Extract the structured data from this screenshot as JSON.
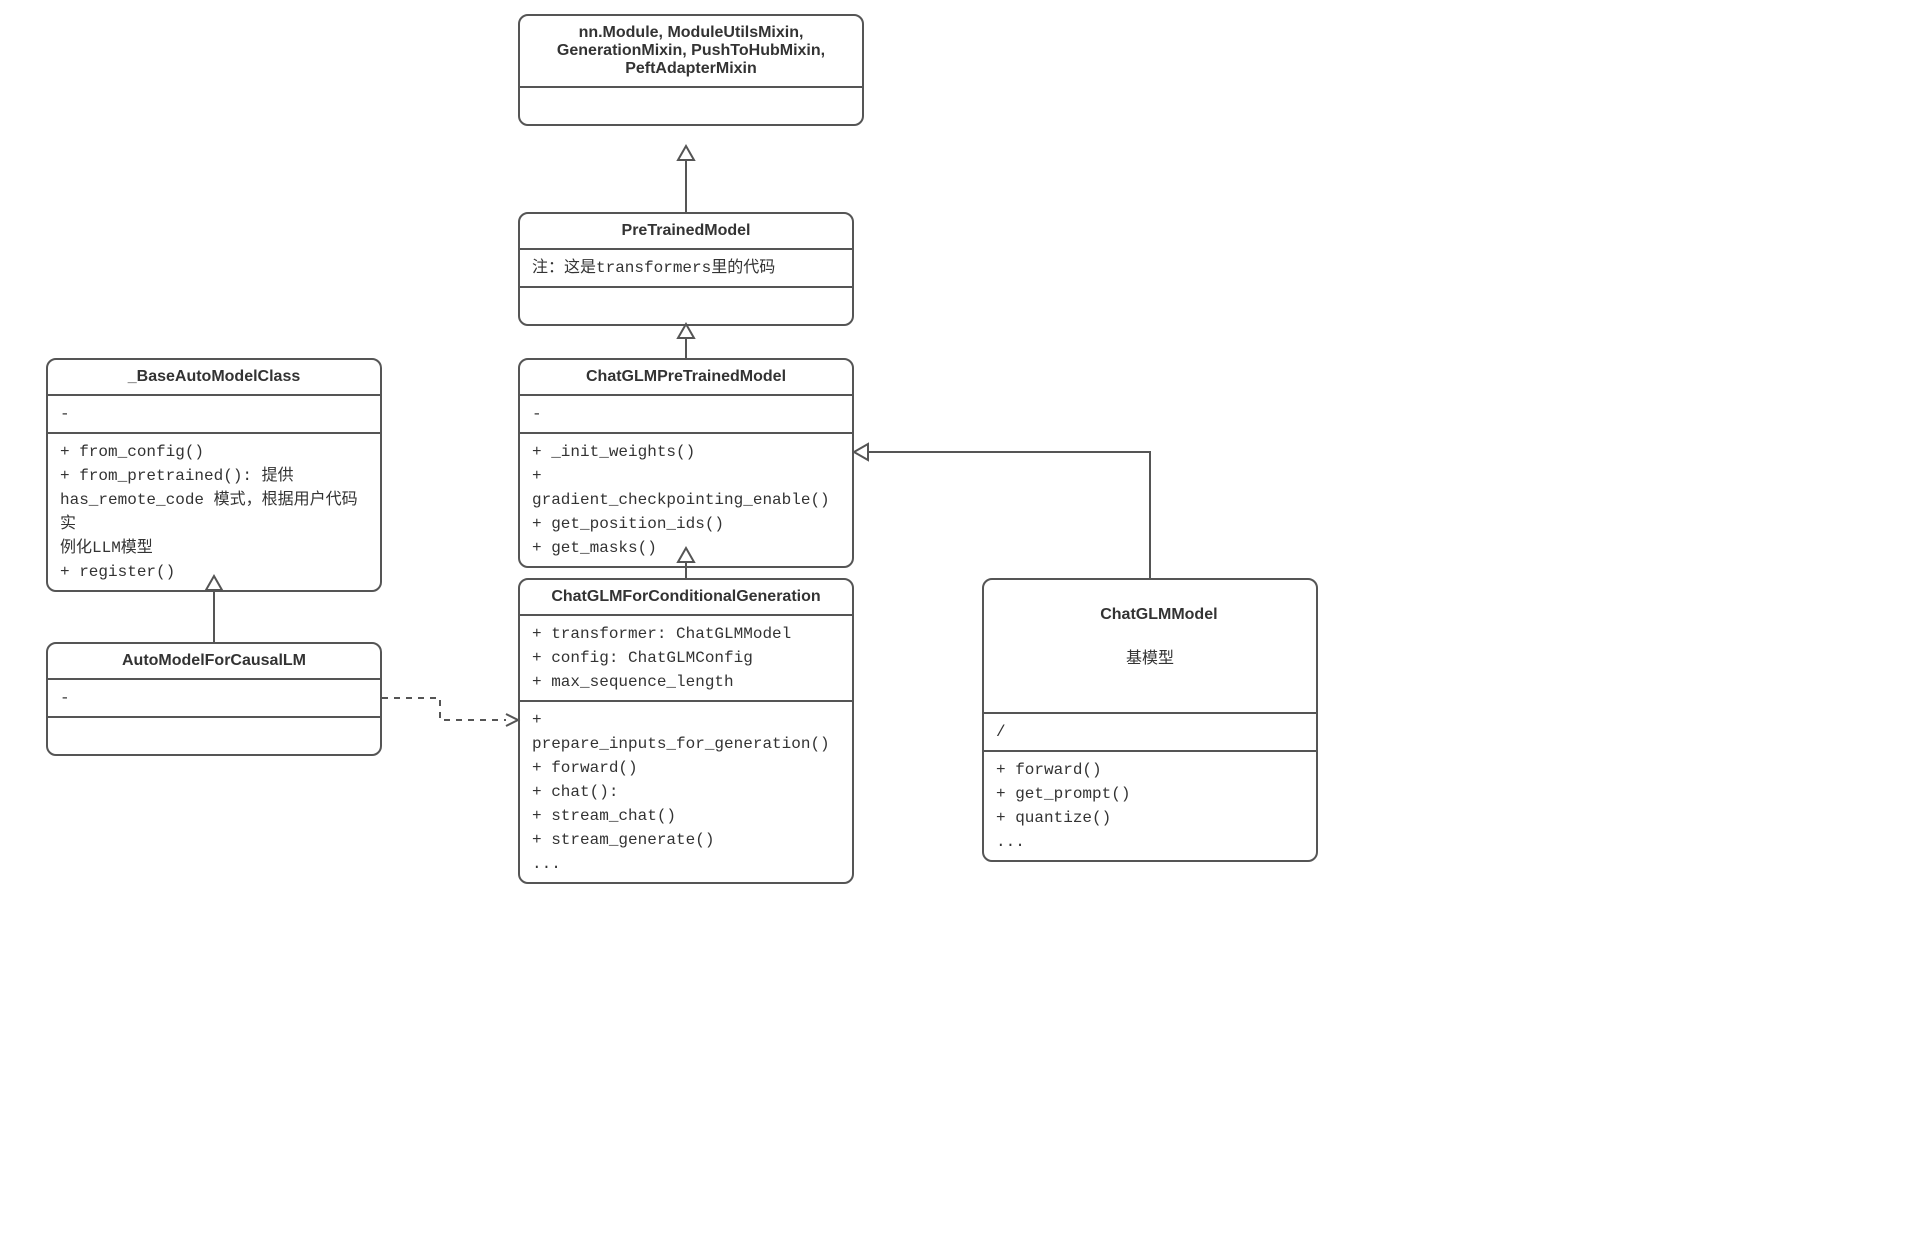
{
  "boxes": {
    "mixins": {
      "title": "nn.Module, ModuleUtilsMixin,\nGenerationMixin, PushToHubMixin,\nPeftAdapterMixin",
      "attrs": "",
      "ops": ""
    },
    "pretrained": {
      "title": "PreTrainedModel",
      "attrs": "注：这是transformers里的代码",
      "ops": ""
    },
    "baseauto": {
      "title": "_BaseAutoModelClass",
      "attrs": "-",
      "ops": "+ from_config()\n+ from_pretrained(): 提供\nhas_remote_code 模式，根据用户代码实\n例化LLM模型\n+ register()"
    },
    "chatglmpretrained": {
      "title": "ChatGLMPreTrainedModel",
      "attrs": "-",
      "ops": "+ _init_weights()\n+ gradient_checkpointing_enable()\n+ get_position_ids()\n+ get_masks()"
    },
    "automodelcausal": {
      "title": "AutoModelForCausalLM",
      "attrs": "-",
      "ops": ""
    },
    "chatglmcondgen": {
      "title": "ChatGLMForConditionalGeneration",
      "attrs": "+ transformer: ChatGLMModel\n+ config: ChatGLMConfig\n+ max_sequence_length",
      "ops": "+ prepare_inputs_for_generation()\n+ forward()\n+ chat():\n+ stream_chat()\n+ stream_generate()\n..."
    },
    "chatglmmodel": {
      "title": "ChatGLMModel",
      "subtitle": "基模型",
      "attrs": "/",
      "ops": "+ forward()\n+ get_prompt()\n+ quantize()\n..."
    }
  }
}
